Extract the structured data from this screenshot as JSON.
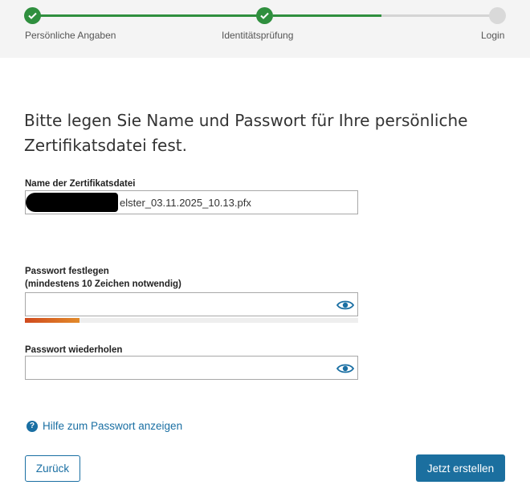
{
  "stepper": {
    "steps": [
      {
        "label": "Persönliche Angaben",
        "state": "done"
      },
      {
        "label": "Identitätsprüfung",
        "state": "done"
      },
      {
        "label": "Login",
        "state": "todo"
      }
    ],
    "colors": {
      "done": "#2f8f3e",
      "todo": "#d9d9d9"
    }
  },
  "heading": "Bitte legen Sie Name und Passwort für Ihre persönliche Zertifikatsdatei fest.",
  "certificate_name": {
    "label": "Name der Zertifikatsdatei",
    "value_visible": "elster_03.11.2025_10.13.pfx"
  },
  "password": {
    "label": "Passwort festlegen",
    "sublabel": "(mindestens 10 Zeichen notwendig)",
    "value": "",
    "strength_fraction": 0.165,
    "toggle_icon": "eye-icon"
  },
  "password_repeat": {
    "label": "Passwort wiederholen",
    "value": "",
    "toggle_icon": "eye-icon"
  },
  "help": {
    "label": "Hilfe zum Passwort anzeigen",
    "icon": "question-circle-icon"
  },
  "buttons": {
    "back": "Zurück",
    "create": "Jetzt erstellen"
  },
  "colors": {
    "accent": "#1a6fa3",
    "primary_button": "#1b6f9f",
    "strength_start": "#d04a1e",
    "strength_end": "#e28a2a"
  }
}
